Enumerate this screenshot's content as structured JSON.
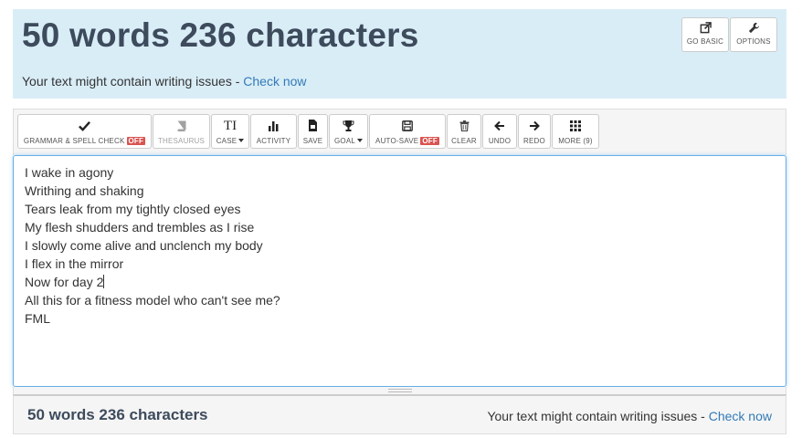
{
  "header": {
    "title": "50 words 236 characters",
    "issues_text": "Your text might contain writing issues - ",
    "issues_link": "Check now",
    "go_basic_label": "GO BASIC",
    "options_label": "OPTIONS"
  },
  "toolbar": {
    "grammar_label": "GRAMMAR & SPELL CHECK",
    "grammar_state": "OFF",
    "thesaurus_label": "THESAURUS",
    "case_label": "CASE",
    "case_icon_text": "TI",
    "activity_label": "ACTIVITY",
    "save_label": "SAVE",
    "goal_label": "GOAL",
    "autosave_label": "AUTO-SAVE",
    "autosave_state": "OFF",
    "clear_label": "CLEAR",
    "undo_label": "UNDO",
    "redo_label": "REDO",
    "more_label": "MORE (9)"
  },
  "editor": {
    "lines": [
      "I wake in agony",
      "Writhing and shaking",
      "Tears leak from my tightly closed eyes",
      "My flesh shudders and trembles as I rise",
      "I slowly come alive and unclench my body",
      "I flex in the mirror",
      "Now for day 2",
      "All this for a fitness model who can't see me?",
      "FML"
    ]
  },
  "footer": {
    "count": "50 words 236 characters",
    "issues_text": "Your text might contain writing issues - ",
    "issues_link": "Check now"
  },
  "colors": {
    "header_bg": "#d9edf7",
    "link": "#337ab7",
    "badge_off": "#d9534f",
    "title": "#3d4b5c",
    "editor_focus_border": "#66afe9"
  }
}
